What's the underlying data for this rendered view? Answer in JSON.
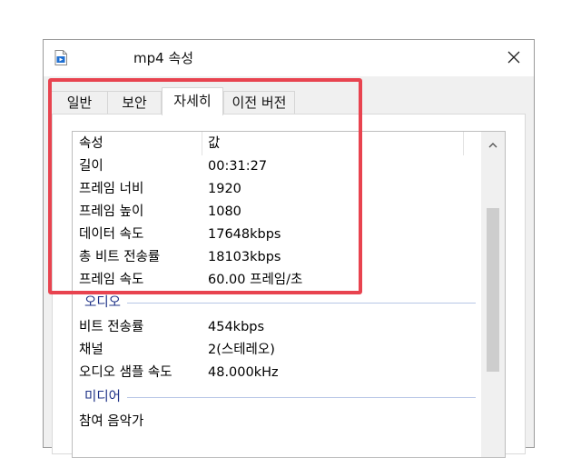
{
  "window": {
    "title": "mp4 속성",
    "close_glyph": "✕"
  },
  "tabs": [
    {
      "label": "일반",
      "active": false
    },
    {
      "label": "보안",
      "active": false
    },
    {
      "label": "자세히",
      "active": true
    },
    {
      "label": "이전 버전",
      "active": false
    }
  ],
  "details": {
    "header": {
      "property": "속성",
      "value": "값"
    },
    "video_rows": [
      {
        "key": "길이",
        "value": "00:31:27"
      },
      {
        "key": "프레임 너비",
        "value": "1920"
      },
      {
        "key": "프레임 높이",
        "value": "1080"
      },
      {
        "key": "데이터 속도",
        "value": "17648kbps"
      },
      {
        "key": "총 비트 전송률",
        "value": "18103kbps"
      },
      {
        "key": "프레임 속도",
        "value": "60.00 프레임/초"
      }
    ],
    "audio_group": "오디오",
    "audio_rows": [
      {
        "key": "비트 전송률",
        "value": "454kbps"
      },
      {
        "key": "채널",
        "value": "2(스테레오)"
      },
      {
        "key": "오디오 샘플 속도",
        "value": "48.000kHz"
      }
    ],
    "media_group": "미디어",
    "media_rows": [
      {
        "key": "참여 음악가",
        "value": ""
      }
    ]
  },
  "colors": {
    "highlight_border": "#e8434f",
    "group_label": "#1e3287",
    "group_line": "#b7c6e6"
  },
  "icons": {
    "file": "video-file-icon",
    "close": "close-icon",
    "scroll_up": "chevron-up-icon"
  }
}
